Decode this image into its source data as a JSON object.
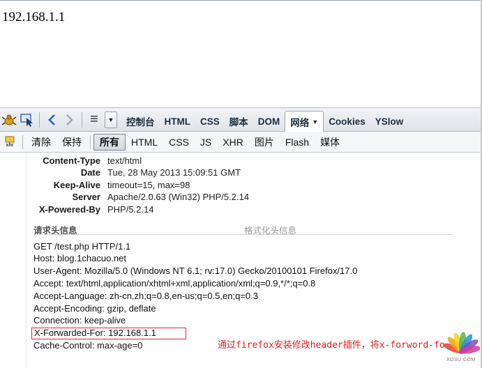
{
  "page": {
    "ip_text": "192.168.1.1"
  },
  "firebug": {
    "tabs": [
      {
        "label": "控制台"
      },
      {
        "label": "HTML"
      },
      {
        "label": "CSS"
      },
      {
        "label": "脚本"
      },
      {
        "label": "DOM"
      },
      {
        "label": "网络",
        "active": true
      },
      {
        "label": "Cookies"
      },
      {
        "label": "YSlow"
      }
    ],
    "active_tab_caret": "▼",
    "list_icon": "≡",
    "dropdown_caret": "▼",
    "icons": [
      "firebug-bug-icon",
      "inspect-element-icon",
      "back-arrow-icon",
      "forward-arrow-icon",
      "panel-menu-icon",
      "dropdown-icon"
    ]
  },
  "net_toolbar": {
    "xhr_label": "xhr",
    "clear": "清除",
    "persist": "保持",
    "filters": [
      {
        "label": "所有",
        "active": true
      },
      {
        "label": "HTML"
      },
      {
        "label": "CSS"
      },
      {
        "label": "JS"
      },
      {
        "label": "XHR"
      },
      {
        "label": "图片"
      },
      {
        "label": "Flash"
      },
      {
        "label": "媒体"
      }
    ]
  },
  "response_headers": [
    {
      "name": "Content-Type",
      "value": "text/html"
    },
    {
      "name": "Date",
      "value": "Tue, 28 May 2013 15:09:51 GMT"
    },
    {
      "name": "Keep-Alive",
      "value": "timeout=15, max=98"
    },
    {
      "name": "Server",
      "value": "Apache/2.0.63 (Win32) PHP/5.2.14"
    },
    {
      "name": "X-Powered-By",
      "value": "PHP/5.2.14"
    }
  ],
  "request_section": {
    "title": "请求头信息",
    "format_link": "格式化头信息"
  },
  "request_lines": [
    "GET /test.php HTTP/1.1",
    "Host: blog.1chacuo.net",
    "User-Agent: Mozilla/5.0 (Windows NT 6.1; rv:17.0) Gecko/20100101 Firefox/17.0",
    "Accept: text/html,application/xhtml+xml,application/xml;q=0.9,*/*;q=0.8",
    "Accept-Language: zh-cn,zh;q=0.8,en-us;q=0.5,en;q=0.3",
    "Accept-Encoding: gzip, deflate",
    "Connection: keep-alive",
    "X-Forwarded-For: 192.168.1.1",
    "Cache-Control: max-age=0"
  ],
  "annotation": "通过firefox安装修改header插件，将x-forword-for",
  "watermark": "XDSU.COM",
  "colors": {
    "highlight_border": "#e0292d",
    "annotation_text": "#e01e1e",
    "toolbar_bg": "#e6e9ed"
  }
}
